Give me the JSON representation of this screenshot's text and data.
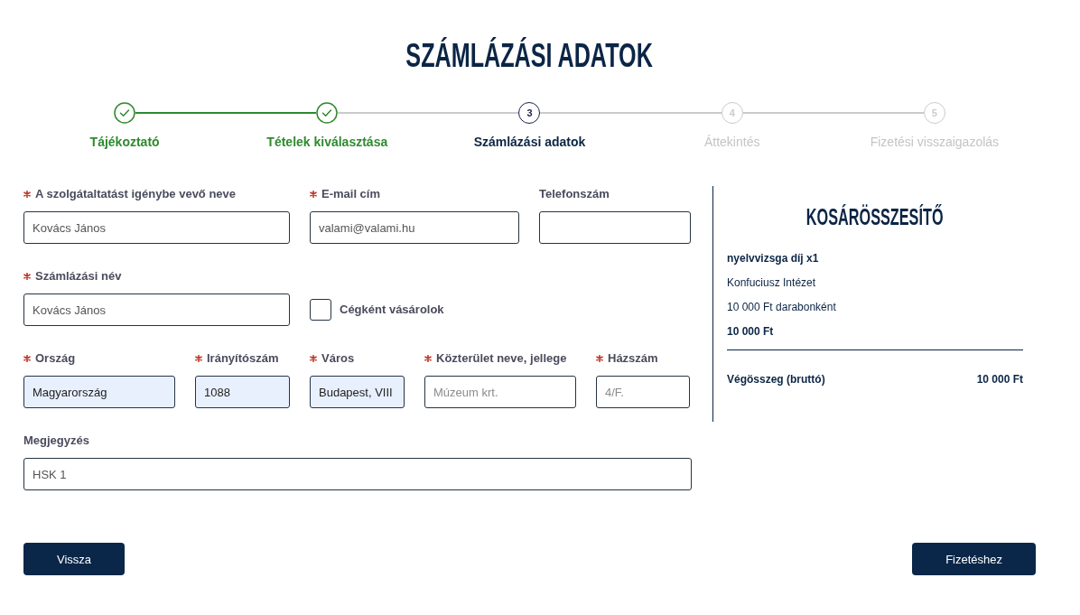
{
  "title": "SZÁMLÁZÁSI ADATOK",
  "steps": [
    {
      "label": "Tájékoztató",
      "completed": true,
      "selected": false
    },
    {
      "label": "Tételek kiválasztása",
      "completed": true,
      "selected": false
    },
    {
      "label": "Számlázási adatok",
      "number": "3",
      "completed": false,
      "selected": true
    },
    {
      "label": "Áttekintés",
      "number": "4",
      "completed": false,
      "selected": false
    },
    {
      "label": "Fizetési visszaigazolás",
      "number": "5",
      "completed": false,
      "selected": false
    }
  ],
  "form": {
    "rows": [
      {
        "fields": [
          {
            "kind": "text",
            "label": "A szolgátaltatást igénybe vevő neve",
            "required": true,
            "value": "Kovács János",
            "autofilled": false
          },
          {
            "kind": "text",
            "label": "E-mail cím",
            "required": true,
            "value": "valami@valami.hu",
            "autofilled": false
          },
          {
            "kind": "text",
            "label": "Telefonszám",
            "required": false,
            "autofilled": false
          }
        ]
      },
      {
        "fields": [
          {
            "kind": "text",
            "label": "Számlázási név",
            "required": true,
            "value": "Kovács János",
            "autofilled": false
          },
          {
            "kind": "checkbox",
            "label": "Cégként vásárolok",
            "checked": false
          }
        ]
      },
      {
        "fields": [
          {
            "kind": "text",
            "label": "Ország",
            "required": true,
            "value": "Magyarország",
            "autofilled": true
          },
          {
            "kind": "text",
            "label": "Irányítószám",
            "required": true,
            "value": "1088",
            "autofilled": true
          },
          {
            "kind": "text",
            "label": "Város",
            "required": true,
            "value": "Budapest, VIII",
            "autofilled": true
          },
          {
            "kind": "text",
            "label": "Közterület neve, jellege",
            "required": true,
            "placeholder": "Múzeum krt.",
            "autofilled": false
          },
          {
            "kind": "text",
            "label": "Házszám",
            "required": true,
            "placeholder": "4/F.",
            "autofilled": false
          }
        ]
      },
      {
        "fields": [
          {
            "kind": "text",
            "label": "Megjegyzés",
            "required": false,
            "value": "HSK 1",
            "autofilled": false
          }
        ]
      }
    ]
  },
  "cart_summary": {
    "title": "KOSÁRÖSSZESÍTŐ",
    "items": [
      {
        "name": "nyelvvizsga díj x1",
        "provider": "Konfuciusz Intézet",
        "unit_price": "10 000 Ft darabonként",
        "price": "10 000 Ft"
      }
    ],
    "total_label": "Végösszeg (bruttó)",
    "total": "10 000 Ft"
  },
  "buttons": [
    {
      "label": "Vissza"
    },
    {
      "label": "Fizetéshez"
    }
  ]
}
